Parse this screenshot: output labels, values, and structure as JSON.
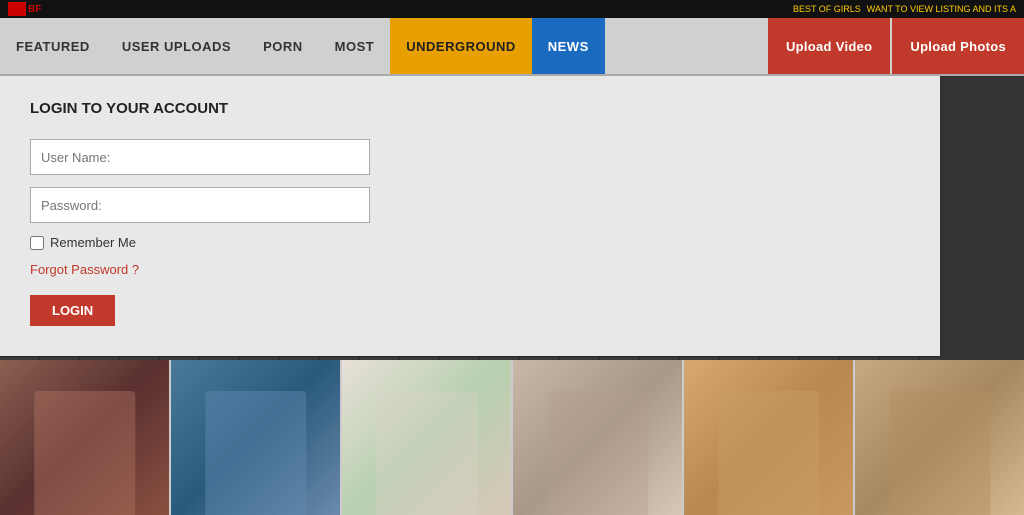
{
  "topbar": {
    "logo_text": "BF",
    "left_link": "BEST OF GIRLS",
    "right_link": "WANT TO VIEW LISTING AND ITS A"
  },
  "nav": {
    "items": [
      {
        "id": "featured",
        "label": "FEATURED",
        "style": "default"
      },
      {
        "id": "user-uploads",
        "label": "USER UPLOADS",
        "style": "default"
      },
      {
        "id": "porn",
        "label": "PORN",
        "style": "default"
      },
      {
        "id": "most",
        "label": "MOST",
        "style": "default"
      },
      {
        "id": "underground",
        "label": "UNDERGROUND",
        "style": "underground"
      },
      {
        "id": "news",
        "label": "NEWS",
        "style": "news"
      }
    ],
    "upload_video_label": "Upload Video",
    "upload_photos_label": "Upload Photos"
  },
  "login": {
    "title": "LOGIN TO YOUR ACCOUNT",
    "username_placeholder": "User Name:",
    "password_placeholder": "Password:",
    "remember_me_label": "Remember Me",
    "forgot_password_label": "Forgot Password ?",
    "login_button_label": "LOGIN"
  },
  "thumbnails": [
    {
      "id": "thumb-1",
      "alt": "thumbnail 1"
    },
    {
      "id": "thumb-2",
      "alt": "thumbnail 2"
    },
    {
      "id": "thumb-3",
      "alt": "thumbnail 3"
    },
    {
      "id": "thumb-4",
      "alt": "thumbnail 4"
    },
    {
      "id": "thumb-5",
      "alt": "thumbnail 5"
    },
    {
      "id": "thumb-6",
      "alt": "thumbnail 6"
    }
  ]
}
